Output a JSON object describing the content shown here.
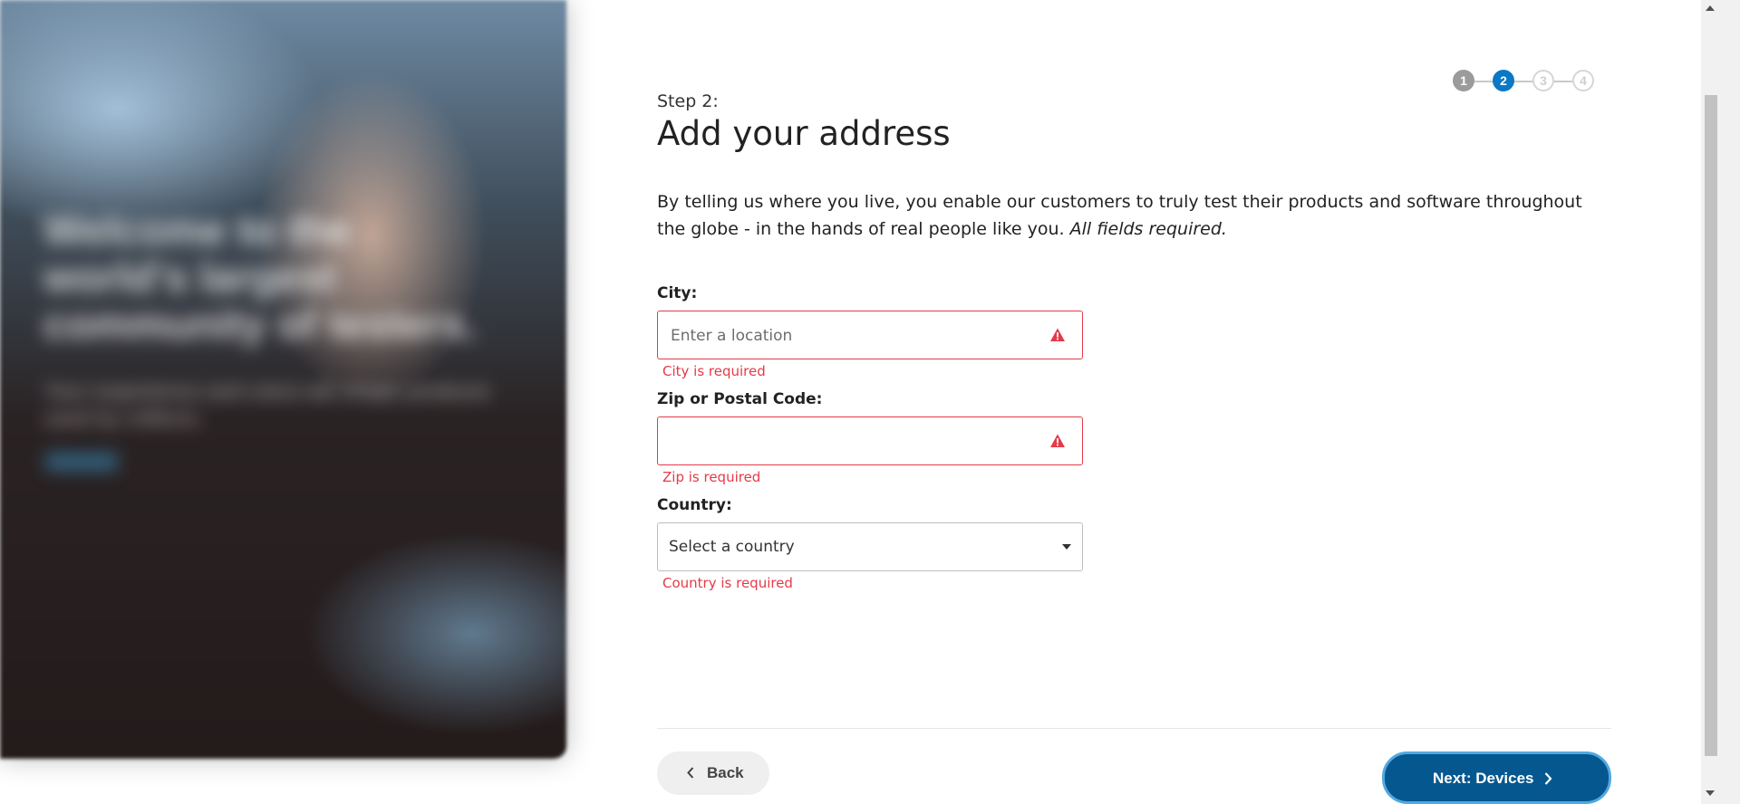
{
  "hero": {
    "headline": "Welcome to the world's largest community of testers.",
    "subtext": "Your experience and voice will shape products used by millions.",
    "link": "Learn more"
  },
  "stepper": {
    "steps": [
      "1",
      "2",
      "3",
      "4"
    ],
    "current_step": 2
  },
  "header": {
    "step_label": "Step 2:",
    "title": "Add your address"
  },
  "intro": {
    "text": "By telling us where you live, you enable our customers to truly test their products and software throughout the globe - in the hands of real people like you.",
    "emphasis": "All fields required."
  },
  "form": {
    "city": {
      "label": "City:",
      "placeholder": "Enter a location",
      "value": "",
      "error": "City is required"
    },
    "zip": {
      "label": "Zip or Postal Code:",
      "placeholder": "",
      "value": "",
      "error": "Zip is required"
    },
    "country": {
      "label": "Country:",
      "selected": "Select a country",
      "error": "Country is required"
    }
  },
  "footer": {
    "back_label": "Back",
    "next_label": "Next: Devices"
  },
  "colors": {
    "accent": "#0b78c6",
    "next_button": "#05588f",
    "error": "#e53a48"
  },
  "icons": {
    "warning": "warning-triangle-icon",
    "caret": "caret-down-icon",
    "back": "chevron-left-icon",
    "next": "chevron-right-icon"
  }
}
